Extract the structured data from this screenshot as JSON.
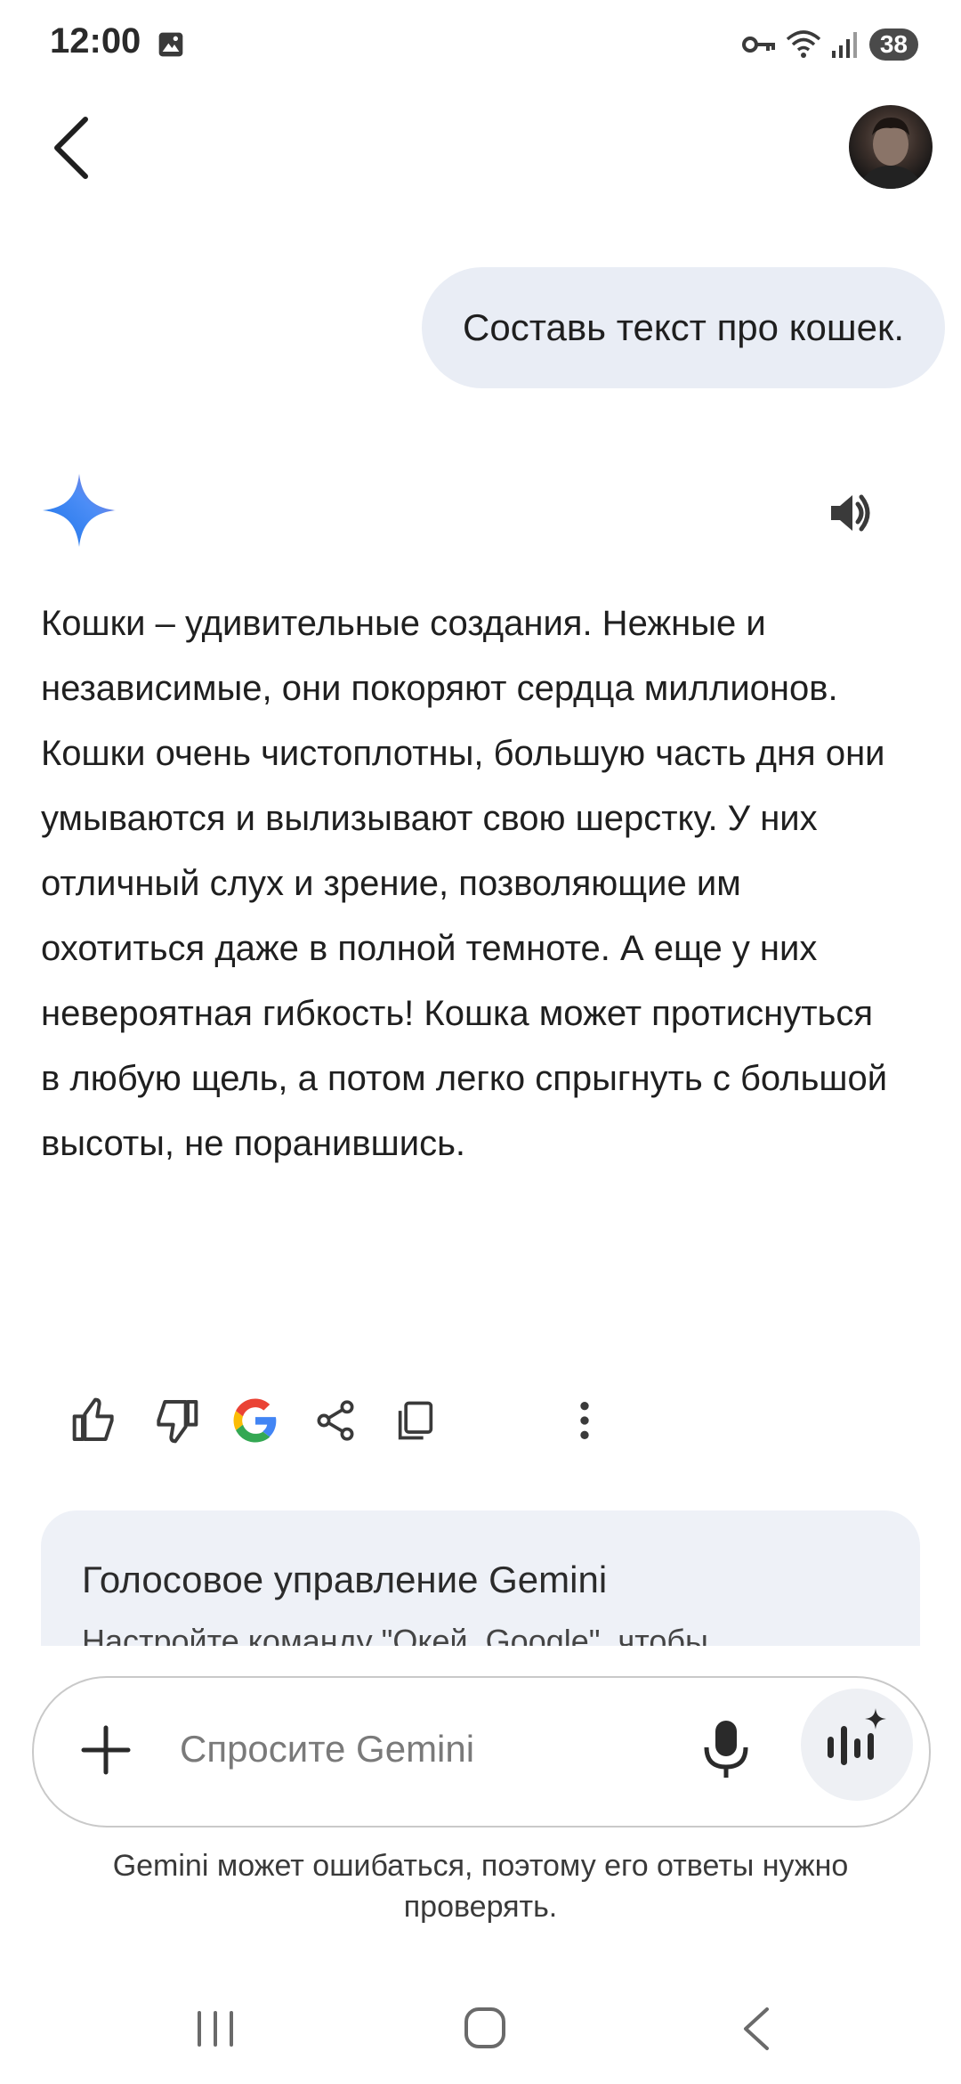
{
  "status_bar": {
    "time": "12:00",
    "battery": "38",
    "icons": [
      "gallery-icon",
      "vpn-key-icon",
      "wifi-icon",
      "signal-icon"
    ]
  },
  "header": {
    "back_icon": "chevron-left-icon",
    "avatar": "user-avatar"
  },
  "chat": {
    "user_message": "Составь текст про кошек.",
    "assistant_icon": "gemini-sparkle-icon",
    "speaker_icon": "volume-icon",
    "response": "Кошки – удивительные создания. Нежные и независимые, они покоряют сердца миллионов. Кошки очень чистоплотны, большую часть дня они умываются и вылизывают свою шерстку. У них отличный слух и зрение, позволяющие им охотиться даже в полной темноте. А еще у них невероятная гибкость! Кошка может протиснуться в любую щель, а потом легко спрыгнуть с большой высоты, не поранившись."
  },
  "actions": [
    "thumbs-up-icon",
    "thumbs-down-icon",
    "google-icon",
    "share-icon",
    "copy-icon",
    "more-vert-icon"
  ],
  "card": {
    "title": "Голосовое управление Gemini",
    "subtitle": "Настройте команду \"Окей, Google\", чтобы"
  },
  "input": {
    "placeholder": "Спросите Gemini",
    "plus_icon": "plus-icon",
    "mic_icon": "mic-icon",
    "live_icon": "gemini-live-icon"
  },
  "disclaimer": "Gemini может ошибаться, поэтому его ответы нужно проверять.",
  "nav": [
    "recent-apps-icon",
    "home-icon",
    "back-icon"
  ],
  "colors": {
    "bubble": "#e9edf5",
    "card": "#eef1f7",
    "accent_blue": "#4285f4"
  }
}
